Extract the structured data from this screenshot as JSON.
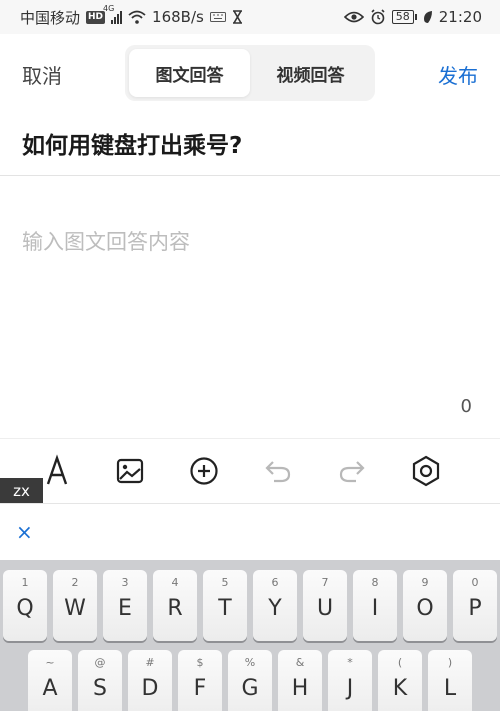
{
  "status_bar": {
    "carrier": "中国移动",
    "hd": "HD",
    "network": "4G",
    "speed": "168B/s",
    "battery": "58",
    "time": "21:20"
  },
  "header": {
    "cancel": "取消",
    "tabs": [
      {
        "label": "图文回答",
        "active": true
      },
      {
        "label": "视频回答",
        "active": false
      }
    ],
    "publish": "发布"
  },
  "question": "如何用键盘打出乘号?",
  "editor": {
    "placeholder": "输入图文回答内容",
    "char_count": "0"
  },
  "toolbar": {
    "icons": [
      "text-format-icon",
      "image-icon",
      "add-circle-icon",
      "undo-icon",
      "redo-icon",
      "settings-icon"
    ]
  },
  "ime": {
    "composition": "zx",
    "close_symbol": "×"
  },
  "keyboard": {
    "row1": [
      {
        "hint": "1",
        "letter": "Q"
      },
      {
        "hint": "2",
        "letter": "W"
      },
      {
        "hint": "3",
        "letter": "E"
      },
      {
        "hint": "4",
        "letter": "R"
      },
      {
        "hint": "5",
        "letter": "T"
      },
      {
        "hint": "6",
        "letter": "Y"
      },
      {
        "hint": "7",
        "letter": "U"
      },
      {
        "hint": "8",
        "letter": "I"
      },
      {
        "hint": "9",
        "letter": "O"
      },
      {
        "hint": "0",
        "letter": "P"
      }
    ],
    "row2": [
      {
        "hint": "~",
        "letter": "A"
      },
      {
        "hint": "@",
        "letter": "S"
      },
      {
        "hint": "#",
        "letter": "D"
      },
      {
        "hint": "$",
        "letter": "F"
      },
      {
        "hint": "%",
        "letter": "G"
      },
      {
        "hint": "&",
        "letter": "H"
      },
      {
        "hint": "*",
        "letter": "J"
      },
      {
        "hint": "(",
        "letter": "K"
      },
      {
        "hint": ")",
        "letter": "L"
      }
    ]
  },
  "colors": {
    "accent": "#1a6fd3",
    "placeholder": "#bdbdbd",
    "keyboard_bg": "#cdced1"
  }
}
